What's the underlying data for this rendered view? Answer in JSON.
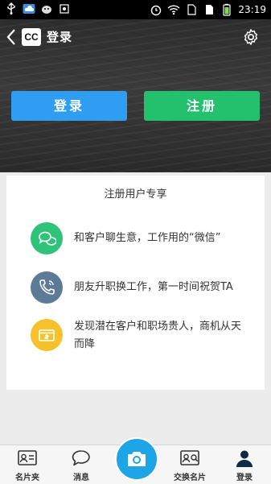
{
  "status_bar": {
    "time": "23:19",
    "icons": [
      "usb-icon",
      "cloud-icon",
      "android-icon",
      "screenshot-icon",
      "alarm-icon",
      "wifi-icon",
      "sim-icon",
      "signal-icon",
      "battery-icon"
    ]
  },
  "header": {
    "logo_text": "CC",
    "title": "登录"
  },
  "actions": {
    "login_label": "登录",
    "register_label": "注册"
  },
  "benefits": {
    "title": "注册用户专享",
    "items": [
      {
        "icon": "chat-icon",
        "text": "和客户聊生意，工作用的“微信”",
        "color": "#2fc37a"
      },
      {
        "icon": "phone-icon",
        "text": "朋友升职换工作，第一时间祝贺TA",
        "color": "#5d7b97"
      },
      {
        "icon": "card-icon",
        "text": "发现潜在客户和职场贵人，商机从天而降",
        "color": "#f5c22b"
      }
    ]
  },
  "tabbar": {
    "items": [
      {
        "label": "名片夹",
        "icon": "contact-card-icon"
      },
      {
        "label": "消息",
        "icon": "message-bubble-icon"
      },
      {
        "label": "",
        "icon": "camera-icon"
      },
      {
        "label": "交换名片",
        "icon": "exchange-card-icon"
      },
      {
        "label": "登录",
        "icon": "user-icon"
      }
    ]
  },
  "colors": {
    "login": "#2f9ef2",
    "register": "#23c06d",
    "camera": "#1ea5e8"
  }
}
